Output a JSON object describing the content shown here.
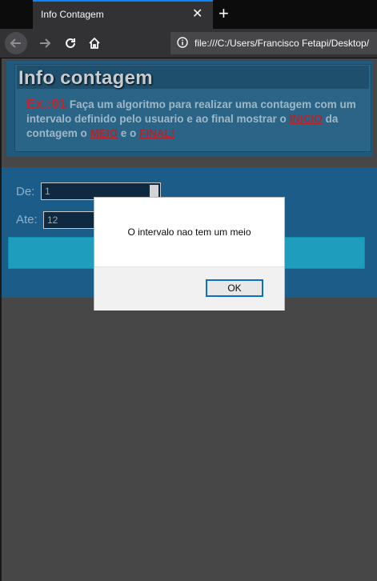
{
  "browser": {
    "tab_title": "Info Contagem",
    "tab_close_glyph": "✕",
    "new_tab_glyph": "+",
    "url": "file:///C:/Users/Francisco Fetapi/Desktop/"
  },
  "page": {
    "heading": "Info contagem",
    "exercise_label": "Ex.:01",
    "description_1": " Faça um algoritmo para realizar uma contagem com um intervalo definido pelo usuario e ao final mostrar o ",
    "link_inicio": "INICIO",
    "description_2": " da contagem o ",
    "link_meio": "MEIO",
    "description_3": " e o ",
    "link_final": "FINAL!",
    "form": {
      "de_label": "De:",
      "de_value": "1",
      "ate_label": "Ate:",
      "ate_value": "12"
    }
  },
  "dialog": {
    "message": "O intervalo nao tem um meio",
    "ok_label": "OK"
  },
  "colors": {
    "accent": "#0a84ff",
    "link_red": "#b2242a",
    "panel_blue": "#1c5c88",
    "button_teal": "#1f9dbd"
  },
  "icons": [
    "back-arrow-icon",
    "forward-arrow-icon",
    "reload-icon",
    "home-icon",
    "info-icon",
    "close-icon",
    "plus-icon",
    "spinner-arrows-icon"
  ]
}
